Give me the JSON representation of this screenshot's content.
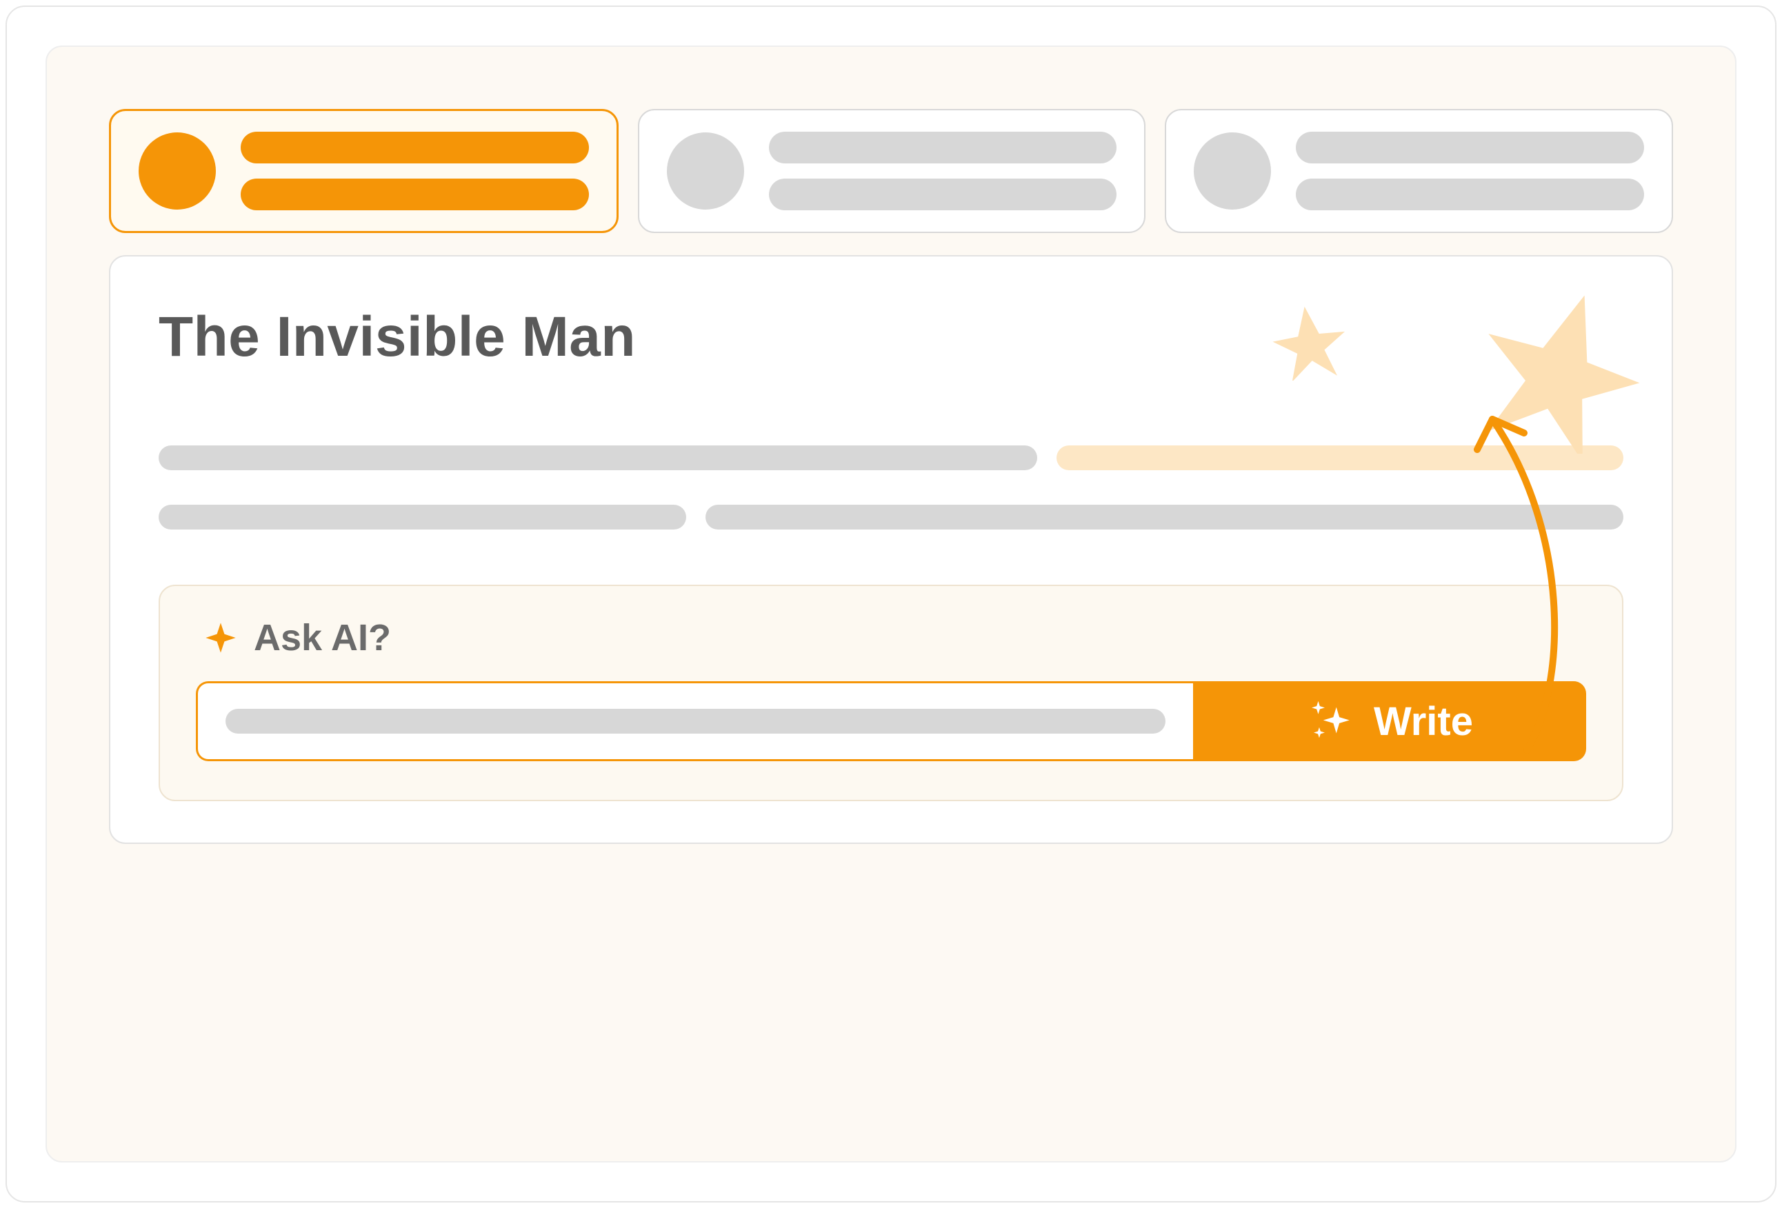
{
  "tabs": [
    {
      "active": true
    },
    {
      "active": false
    },
    {
      "active": false
    }
  ],
  "content": {
    "title": "The Invisible Man"
  },
  "ask_ai": {
    "label": "Ask AI?",
    "write_button_label": "Write"
  },
  "icons": {
    "sparkle_small": "sparkle-icon",
    "sparkles_button": "sparkles-icon",
    "star_big": "star-icon",
    "star_small": "star-icon"
  },
  "colors": {
    "accent": "#f59507",
    "accent_light": "#fde7c5",
    "bg_cream": "#fdf9f3",
    "placeholder": "#d7d7d7",
    "text_title": "#595959"
  }
}
